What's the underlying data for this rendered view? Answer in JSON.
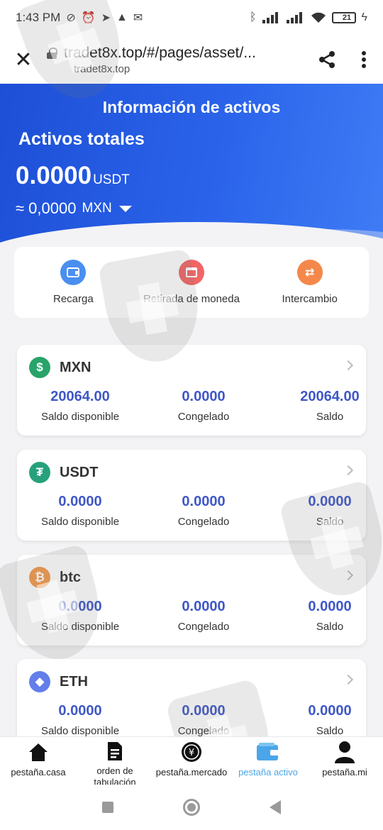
{
  "status_bar": {
    "time": "1:43 PM",
    "battery": "21"
  },
  "browser": {
    "url": "tradet8x.top/#/pages/asset/...",
    "host": "tradet8x.top"
  },
  "header": {
    "title": "Información de activos",
    "total_label": "Activos totales",
    "total_amount": "0.0000",
    "total_unit": "USDT",
    "fiat_amount": "≈ 0,0000",
    "fiat_currency": "MXN"
  },
  "actions": [
    {
      "label": "Recarga",
      "icon": "wallet-icon",
      "color": "#4a8ff0"
    },
    {
      "label": "Retirada de moneda",
      "icon": "withdraw-icon",
      "color": "#f06666"
    },
    {
      "label": "Intercambio",
      "icon": "exchange-icon",
      "color": "#f4884a"
    }
  ],
  "assets": [
    {
      "name": "MXN",
      "icon": "dollar-icon",
      "color": "#29a36a",
      "available": "20064.00",
      "available_label": "Saldo disponible",
      "frozen": "0.0000",
      "frozen_label": "Congelado",
      "balance": "20064.00",
      "balance_label": "Saldo"
    },
    {
      "name": "USDT",
      "icon": "tether-icon",
      "color": "#26a17b",
      "available": "0.0000",
      "available_label": "Saldo disponible",
      "frozen": "0.0000",
      "frozen_label": "Congelado",
      "balance": "0.0000",
      "balance_label": "Saldo"
    },
    {
      "name": "btc",
      "icon": "bitcoin-icon",
      "color": "#f2994a",
      "available": "0.0000",
      "available_label": "Saldo disponible",
      "frozen": "0.0000",
      "frozen_label": "Congelado",
      "balance": "0.0000",
      "balance_label": "Saldo"
    },
    {
      "name": "ETH",
      "icon": "ethereum-icon",
      "color": "#627eea",
      "available": "0.0000",
      "available_label": "Saldo disponible",
      "frozen": "0.0000",
      "frozen_label": "Congelado",
      "balance": "0.0000",
      "balance_label": "Saldo"
    }
  ],
  "bottom_nav": [
    {
      "label": "pestaña.casa",
      "icon": "home-icon"
    },
    {
      "label": "orden de tabulación",
      "icon": "document-icon"
    },
    {
      "label": "pestaña.mercado",
      "icon": "market-icon"
    },
    {
      "label": "pestaña activo",
      "icon": "wallet-icon",
      "active": true,
      "active_color": "#4aa6e8"
    },
    {
      "label": "pestaña.mi",
      "icon": "user-icon"
    }
  ]
}
